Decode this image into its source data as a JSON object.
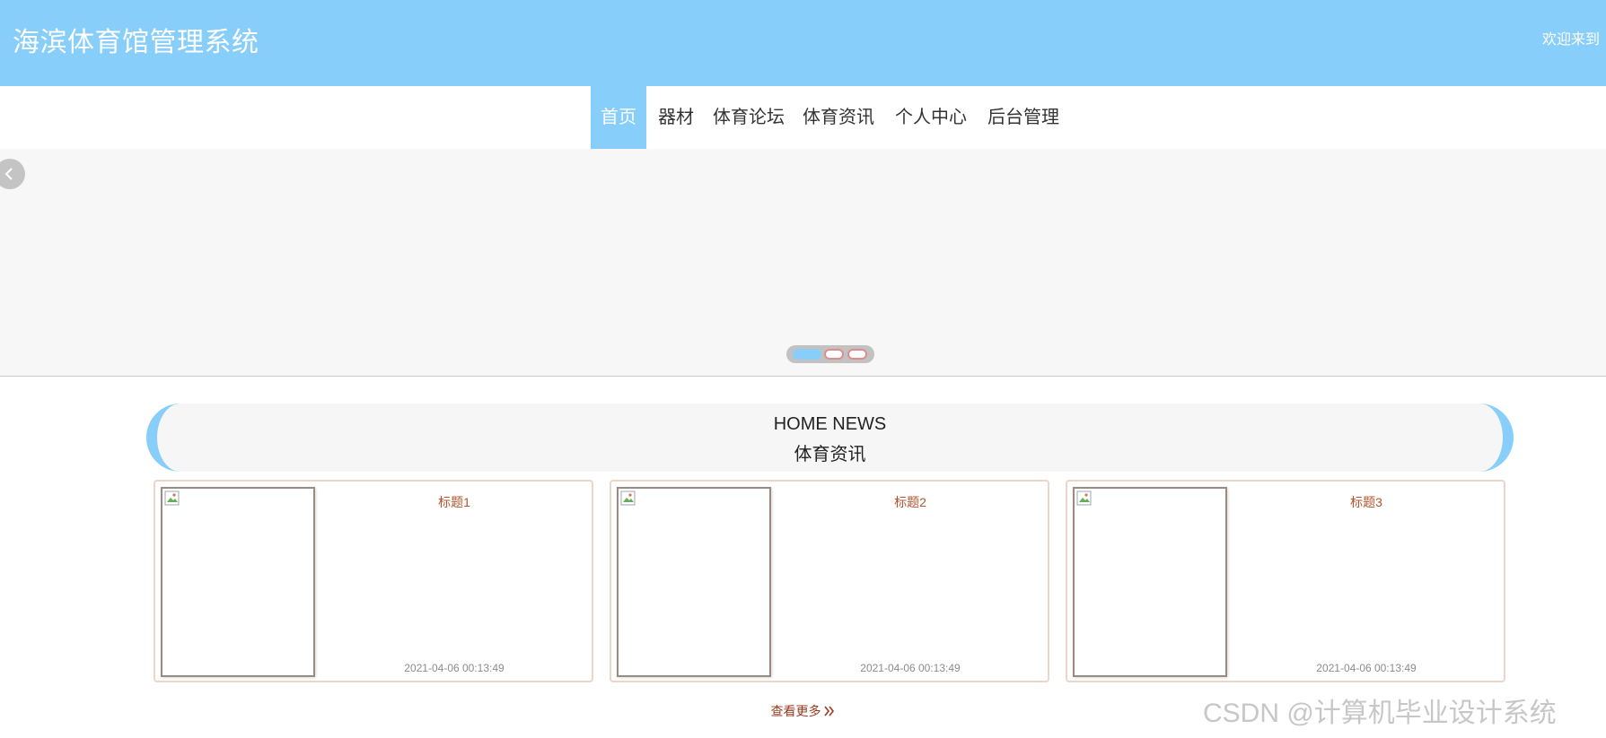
{
  "header": {
    "title": "海滨体育馆管理系统",
    "welcome_text": "欢迎来到",
    "background_color": "#88cefa"
  },
  "nav": {
    "items": [
      {
        "label": "首页",
        "active": true
      },
      {
        "label": "器材",
        "active": false
      },
      {
        "label": "体育论坛",
        "active": false
      },
      {
        "label": "体育资讯",
        "active": false
      },
      {
        "label": "个人中心",
        "active": false
      },
      {
        "label": "后台管理",
        "active": false
      }
    ],
    "active_color": "#88cefa"
  },
  "carousel": {
    "prev_icon": "chevron-left-icon",
    "slide_count": 3,
    "active_index": 0
  },
  "news_section": {
    "title_en": "HOME NEWS",
    "title_zh": "体育资讯",
    "cards": [
      {
        "title": "标题1",
        "time": "2021-04-06 00:13:49",
        "image": "broken-image-icon"
      },
      {
        "title": "标题2",
        "time": "2021-04-06 00:13:49",
        "image": "broken-image-icon"
      },
      {
        "title": "标题3",
        "time": "2021-04-06 00:13:49",
        "image": "broken-image-icon"
      }
    ],
    "view_more": "查看更多",
    "view_more_icon": "double-chevron-right-icon"
  },
  "watermark": "CSDN @计算机毕业设计系统"
}
